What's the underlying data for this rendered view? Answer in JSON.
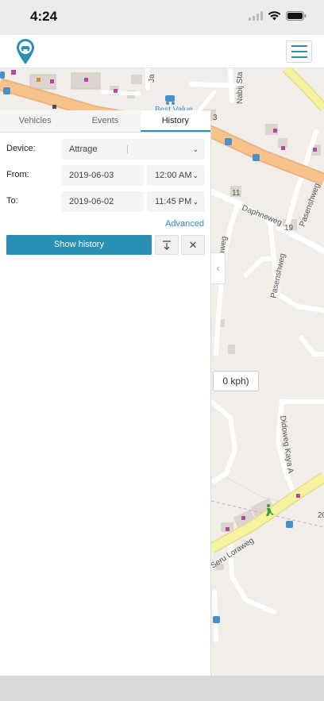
{
  "status_bar": {
    "time": "4:24"
  },
  "tabs": [
    {
      "label": "Vehicles"
    },
    {
      "label": "Events"
    },
    {
      "label": "History"
    }
  ],
  "form": {
    "device_label": "Device:",
    "device_value": "Attrage",
    "from_label": "From:",
    "from_date": "2019-06-03",
    "from_time": "12:00 AM",
    "to_label": "To:",
    "to_date": "2019-06-02",
    "to_time": "11:45 PM",
    "advanced_link": "Advanced",
    "show_history_label": "Show history"
  },
  "map": {
    "speed_label": "0 kph)",
    "street_labels": {
      "daphneweg": "Daphneweg",
      "pasenshweg_1": "Pasenshweg",
      "pasenshweg_2": "Pasenshweg",
      "loraweg": "Loraweg",
      "didoweg": "Didoweg Kaya A",
      "seru_loraweg": "Seru Loraweg",
      "best_value": "Best Value",
      "nabij": "Nabij Sta",
      "ja": "Ja",
      "num_19": "19",
      "num_11": "11",
      "num_3": "3",
      "num_20": "20"
    }
  },
  "colors": {
    "accent": "#2a8fb5",
    "road_major": "#f7c38a",
    "road_yellow": "#f6f2a0",
    "map_bg": "#f1eee9"
  }
}
